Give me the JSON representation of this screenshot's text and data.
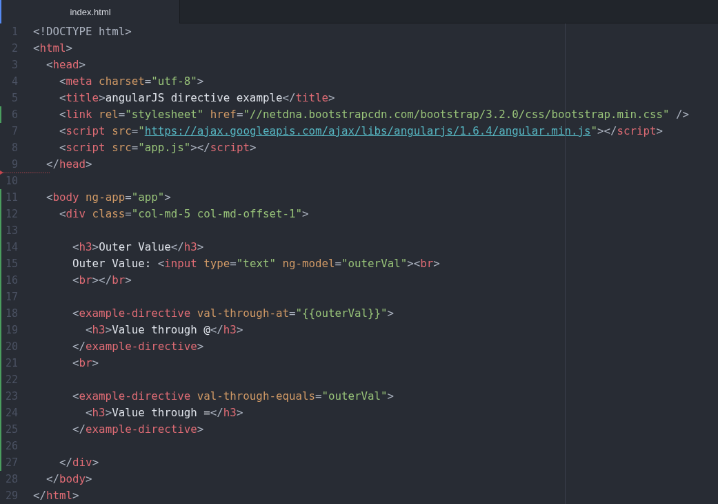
{
  "tabs": [
    {
      "label": "index.html",
      "selected": true
    }
  ],
  "lines": [
    {
      "number": "1",
      "added": false,
      "deleted_below": false,
      "tokens": [
        {
          "kind": "punct",
          "text": "<!DOCTYPE html>"
        }
      ]
    },
    {
      "number": "2",
      "added": false,
      "deleted_below": false,
      "tokens": [
        {
          "kind": "punct",
          "text": "<"
        },
        {
          "kind": "tag",
          "text": "html"
        },
        {
          "kind": "punct",
          "text": ">"
        }
      ]
    },
    {
      "number": "3",
      "added": false,
      "deleted_below": false,
      "tokens": [
        {
          "kind": "punct",
          "text": "  <"
        },
        {
          "kind": "tag",
          "text": "head"
        },
        {
          "kind": "punct",
          "text": ">"
        }
      ]
    },
    {
      "number": "4",
      "added": false,
      "deleted_below": false,
      "tokens": [
        {
          "kind": "punct",
          "text": "    <"
        },
        {
          "kind": "tag",
          "text": "meta"
        },
        {
          "kind": "attr",
          "text": " charset"
        },
        {
          "kind": "punct",
          "text": "="
        },
        {
          "kind": "string",
          "text": "\"utf-8\""
        },
        {
          "kind": "punct",
          "text": ">"
        }
      ]
    },
    {
      "number": "5",
      "added": false,
      "deleted_below": false,
      "tokens": [
        {
          "kind": "punct",
          "text": "    <"
        },
        {
          "kind": "tag",
          "text": "title"
        },
        {
          "kind": "punct",
          "text": ">"
        },
        {
          "kind": "text",
          "text": "angularJS directive example"
        },
        {
          "kind": "punct",
          "text": "</"
        },
        {
          "kind": "tag",
          "text": "title"
        },
        {
          "kind": "punct",
          "text": ">"
        }
      ]
    },
    {
      "number": "6",
      "added": true,
      "deleted_below": false,
      "tokens": [
        {
          "kind": "punct",
          "text": "    <"
        },
        {
          "kind": "tag",
          "text": "link"
        },
        {
          "kind": "attr",
          "text": " rel"
        },
        {
          "kind": "punct",
          "text": "="
        },
        {
          "kind": "string",
          "text": "\"stylesheet\""
        },
        {
          "kind": "attr",
          "text": " href"
        },
        {
          "kind": "punct",
          "text": "="
        },
        {
          "kind": "string",
          "text": "\"//netdna.bootstrapcdn.com/bootstrap/3.2.0/css/bootstrap.min.css\""
        },
        {
          "kind": "punct",
          "text": " />"
        }
      ]
    },
    {
      "number": "7",
      "added": false,
      "deleted_below": false,
      "tokens": [
        {
          "kind": "punct",
          "text": "    <"
        },
        {
          "kind": "tag",
          "text": "script"
        },
        {
          "kind": "attr",
          "text": " src"
        },
        {
          "kind": "punct",
          "text": "="
        },
        {
          "kind": "string",
          "text": "\""
        },
        {
          "kind": "link",
          "text": "https://ajax.googleapis.com/ajax/libs/angularjs/1.6.4/angular.min.js"
        },
        {
          "kind": "string",
          "text": "\""
        },
        {
          "kind": "punct",
          "text": "></"
        },
        {
          "kind": "tag",
          "text": "script"
        },
        {
          "kind": "punct",
          "text": ">"
        }
      ]
    },
    {
      "number": "8",
      "added": false,
      "deleted_below": false,
      "tokens": [
        {
          "kind": "punct",
          "text": "    <"
        },
        {
          "kind": "tag",
          "text": "script"
        },
        {
          "kind": "attr",
          "text": " src"
        },
        {
          "kind": "punct",
          "text": "="
        },
        {
          "kind": "string",
          "text": "\"app.js\""
        },
        {
          "kind": "punct",
          "text": "></"
        },
        {
          "kind": "tag",
          "text": "script"
        },
        {
          "kind": "punct",
          "text": ">"
        }
      ]
    },
    {
      "number": "9",
      "added": false,
      "deleted_below": true,
      "tokens": [
        {
          "kind": "punct",
          "text": "  </"
        },
        {
          "kind": "tag",
          "text": "head"
        },
        {
          "kind": "punct",
          "text": ">"
        }
      ]
    },
    {
      "number": "10",
      "added": false,
      "deleted_below": false
    },
    {
      "number": "11",
      "added": true,
      "deleted_below": false,
      "tokens": [
        {
          "kind": "punct",
          "text": "  <"
        },
        {
          "kind": "tag",
          "text": "body"
        },
        {
          "kind": "attr",
          "text": " ng-app"
        },
        {
          "kind": "punct",
          "text": "="
        },
        {
          "kind": "string",
          "text": "\"app\""
        },
        {
          "kind": "punct",
          "text": ">"
        }
      ]
    },
    {
      "number": "12",
      "added": true,
      "deleted_below": false,
      "tokens": [
        {
          "kind": "punct",
          "text": "    <"
        },
        {
          "kind": "tag",
          "text": "div"
        },
        {
          "kind": "attr",
          "text": " class"
        },
        {
          "kind": "punct",
          "text": "="
        },
        {
          "kind": "string",
          "text": "\"col-md-5 col-md-offset-1\""
        },
        {
          "kind": "punct",
          "text": ">"
        }
      ]
    },
    {
      "number": "13",
      "added": true,
      "deleted_below": false
    },
    {
      "number": "14",
      "added": true,
      "deleted_below": false,
      "tokens": [
        {
          "kind": "punct",
          "text": "      <"
        },
        {
          "kind": "tag",
          "text": "h3"
        },
        {
          "kind": "punct",
          "text": ">"
        },
        {
          "kind": "text",
          "text": "Outer Value"
        },
        {
          "kind": "punct",
          "text": "</"
        },
        {
          "kind": "tag",
          "text": "h3"
        },
        {
          "kind": "punct",
          "text": ">"
        }
      ]
    },
    {
      "number": "15",
      "added": true,
      "deleted_below": false,
      "tokens": [
        {
          "kind": "text",
          "text": "      Outer Value: "
        },
        {
          "kind": "punct",
          "text": "<"
        },
        {
          "kind": "tag",
          "text": "input"
        },
        {
          "kind": "attr",
          "text": " type"
        },
        {
          "kind": "punct",
          "text": "="
        },
        {
          "kind": "string",
          "text": "\"text\""
        },
        {
          "kind": "attr",
          "text": " ng-model"
        },
        {
          "kind": "punct",
          "text": "="
        },
        {
          "kind": "string",
          "text": "\"outerVal\""
        },
        {
          "kind": "punct",
          "text": "><"
        },
        {
          "kind": "tag",
          "text": "br"
        },
        {
          "kind": "punct",
          "text": ">"
        }
      ]
    },
    {
      "number": "16",
      "added": true,
      "deleted_below": false,
      "tokens": [
        {
          "kind": "punct",
          "text": "      <"
        },
        {
          "kind": "tag",
          "text": "br"
        },
        {
          "kind": "punct",
          "text": "></"
        },
        {
          "kind": "tag",
          "text": "br"
        },
        {
          "kind": "punct",
          "text": ">"
        }
      ]
    },
    {
      "number": "17",
      "added": true,
      "deleted_below": false
    },
    {
      "number": "18",
      "added": true,
      "deleted_below": false,
      "tokens": [
        {
          "kind": "punct",
          "text": "      <"
        },
        {
          "kind": "tag",
          "text": "example-directive"
        },
        {
          "kind": "attr",
          "text": " val-through-at"
        },
        {
          "kind": "punct",
          "text": "="
        },
        {
          "kind": "string",
          "text": "\"{{outerVal}}\""
        },
        {
          "kind": "punct",
          "text": ">"
        }
      ]
    },
    {
      "number": "19",
      "added": true,
      "deleted_below": false,
      "tokens": [
        {
          "kind": "punct",
          "text": "        <"
        },
        {
          "kind": "tag",
          "text": "h3"
        },
        {
          "kind": "punct",
          "text": ">"
        },
        {
          "kind": "text",
          "text": "Value through @"
        },
        {
          "kind": "punct",
          "text": "</"
        },
        {
          "kind": "tag",
          "text": "h3"
        },
        {
          "kind": "punct",
          "text": ">"
        }
      ]
    },
    {
      "number": "20",
      "added": true,
      "deleted_below": false,
      "tokens": [
        {
          "kind": "punct",
          "text": "      </"
        },
        {
          "kind": "tag",
          "text": "example-directive"
        },
        {
          "kind": "punct",
          "text": ">"
        }
      ]
    },
    {
      "number": "21",
      "added": true,
      "deleted_below": false,
      "tokens": [
        {
          "kind": "punct",
          "text": "      <"
        },
        {
          "kind": "tag",
          "text": "br"
        },
        {
          "kind": "punct",
          "text": ">"
        }
      ]
    },
    {
      "number": "22",
      "added": true,
      "deleted_below": false
    },
    {
      "number": "23",
      "added": true,
      "deleted_below": false,
      "tokens": [
        {
          "kind": "punct",
          "text": "      <"
        },
        {
          "kind": "tag",
          "text": "example-directive"
        },
        {
          "kind": "attr",
          "text": " val-through-equals"
        },
        {
          "kind": "punct",
          "text": "="
        },
        {
          "kind": "string",
          "text": "\"outerVal\""
        },
        {
          "kind": "punct",
          "text": ">"
        }
      ]
    },
    {
      "number": "24",
      "added": true,
      "deleted_below": false,
      "tokens": [
        {
          "kind": "punct",
          "text": "        <"
        },
        {
          "kind": "tag",
          "text": "h3"
        },
        {
          "kind": "punct",
          "text": ">"
        },
        {
          "kind": "text",
          "text": "Value through ="
        },
        {
          "kind": "punct",
          "text": "</"
        },
        {
          "kind": "tag",
          "text": "h3"
        },
        {
          "kind": "punct",
          "text": ">"
        }
      ]
    },
    {
      "number": "25",
      "added": true,
      "deleted_below": false,
      "tokens": [
        {
          "kind": "punct",
          "text": "      </"
        },
        {
          "kind": "tag",
          "text": "example-directive"
        },
        {
          "kind": "punct",
          "text": ">"
        }
      ]
    },
    {
      "number": "26",
      "added": true,
      "deleted_below": false
    },
    {
      "number": "27",
      "added": true,
      "deleted_below": false,
      "tokens": [
        {
          "kind": "punct",
          "text": "    </"
        },
        {
          "kind": "tag",
          "text": "div"
        },
        {
          "kind": "punct",
          "text": ">"
        }
      ]
    },
    {
      "number": "28",
      "added": false,
      "deleted_below": false,
      "tokens": [
        {
          "kind": "punct",
          "text": "  </"
        },
        {
          "kind": "tag",
          "text": "body"
        },
        {
          "kind": "punct",
          "text": ">"
        }
      ]
    },
    {
      "number": "29",
      "added": false,
      "deleted_below": false,
      "tokens": [
        {
          "kind": "punct",
          "text": "</"
        },
        {
          "kind": "tag",
          "text": "html"
        },
        {
          "kind": "punct",
          "text": ">"
        }
      ]
    }
  ]
}
